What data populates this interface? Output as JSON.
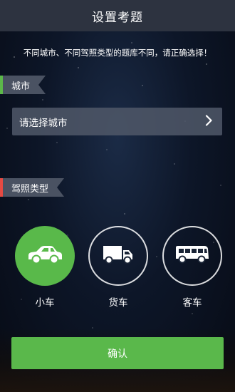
{
  "header": {
    "title": "设置考题"
  },
  "notice": "不同城市、不同驾照类型的题库不同，请正确选择！",
  "city": {
    "tag_label": "城市",
    "select_placeholder": "请选择城市"
  },
  "license": {
    "tag_label": "驾照类型",
    "options": [
      {
        "label": "小车",
        "icon": "car-icon",
        "selected": true
      },
      {
        "label": "货车",
        "icon": "truck-icon",
        "selected": false
      },
      {
        "label": "客车",
        "icon": "bus-icon",
        "selected": false
      }
    ]
  },
  "confirm_label": "确认",
  "colors": {
    "accent_green": "#5ab84b",
    "city_marker": "#5cb84a",
    "license_marker": "#e64a43",
    "header_bg": "#2d3340"
  }
}
